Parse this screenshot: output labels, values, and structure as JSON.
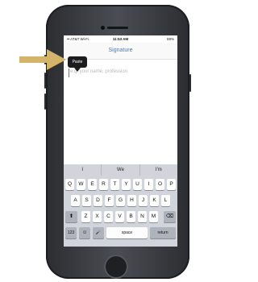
{
  "status_bar": {
    "carrier": "•• AT&T Wi-Fi",
    "time": "11:53 AM",
    "battery": "69%"
  },
  "nav": {
    "title": "Signature"
  },
  "field": {
    "placeholder": "e.g. your name, profession"
  },
  "paste_menu": {
    "label": "Paste"
  },
  "suggestions": [
    "I",
    "We",
    "I'm"
  ],
  "keyboard": {
    "row1": [
      "Q",
      "W",
      "E",
      "R",
      "T",
      "Y",
      "U",
      "I",
      "O",
      "P"
    ],
    "row2": [
      "A",
      "S",
      "D",
      "F",
      "G",
      "H",
      "J",
      "K",
      "L"
    ],
    "row3": [
      "Z",
      "X",
      "C",
      "V",
      "B",
      "N",
      "M"
    ],
    "shift": "⬆",
    "delete": "⌫",
    "numbers": "123",
    "emoji": "☺",
    "mic": "🎤",
    "space": "space",
    "return": "return"
  },
  "colors": {
    "accent": "#2f7df6",
    "arrow": "#d4b46a"
  }
}
